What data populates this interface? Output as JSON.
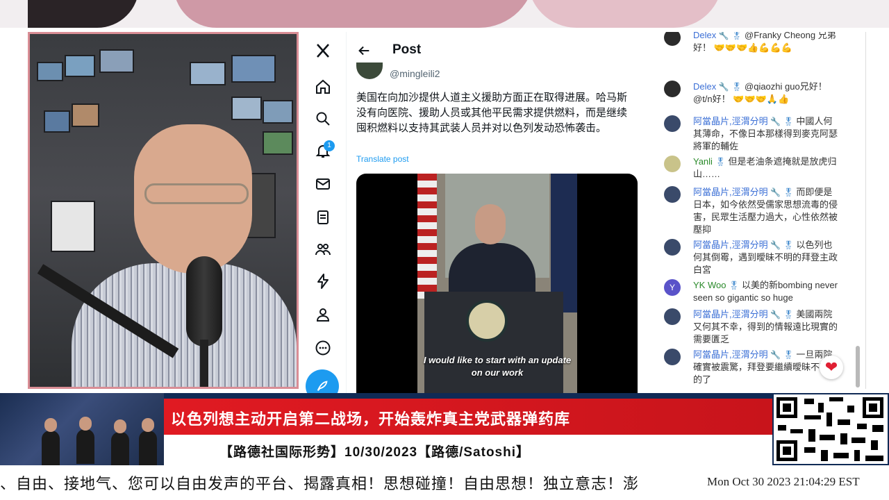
{
  "twitter": {
    "logo": "X",
    "nav_icons": [
      "x-logo",
      "home-icon",
      "search-icon",
      "bell-icon",
      "mail-icon",
      "list-icon",
      "communities-icon",
      "bolt-icon",
      "profile-icon",
      "more-icon"
    ],
    "notification_count": "1",
    "post_title": "Post",
    "handle": "@mingleili2",
    "post_text": "美国在向加沙提供人道主义援助方面正在取得进展。哈马斯没有向医院、援助人员或其他平民需求提供燃料，而是继续囤积燃料以支持其武装人员并对以色列发动恐怖袭击。",
    "translate_label": "Translate post",
    "video_caption": "I would like to start with an update on our work"
  },
  "chat": {
    "messages": [
      {
        "author": "Delex",
        "badges": "🔧 🎖",
        "text": "@Franky Cheong 兄弟好！",
        "emoji": "🤝🤝🤝👍💪💪💪"
      },
      {
        "author": "Delex",
        "badges": "🔧 🎖",
        "text": "@qiaozhi guo兄好！@t/n好！",
        "emoji": "🤝🤝🤝🙏👍"
      },
      {
        "author": "阿當晶片,涇渭分明",
        "badges": "🔧 🎖",
        "text": "中國人何其薄命，不像日本那樣得到麥克阿瑟將軍的輔佐",
        "emoji": ""
      },
      {
        "author": "Yanli",
        "badges": "🎖",
        "text": "但是老油条遮掩就是放虎归山……",
        "emoji": ""
      },
      {
        "author": "阿當晶片,涇渭分明",
        "badges": "🔧 🎖",
        "text": "而即便是日本，如今依然受儒家思想流毒的侵害，民眾生活壓力過大，心性依然被壓抑",
        "emoji": ""
      },
      {
        "author": "阿當晶片,涇渭分明",
        "badges": "🔧 🎖",
        "text": "以色列也何其倒霉，遇到曖昧不明的拜登主政白宮",
        "emoji": ""
      },
      {
        "author": "YK Woo",
        "badges": "🎖",
        "text": "以美的新bombing never seen so gigantic so huge",
        "emoji": ""
      },
      {
        "author": "阿當晶片,涇渭分明",
        "badges": "🔧 🎖",
        "text": "美國兩院又何其不幸，得到的情報遠比現實的需要匱乏",
        "emoji": ""
      },
      {
        "author": "阿當晶片,涇渭分明",
        "badges": "🔧 🎖",
        "text": "一旦兩院確實被震驚，拜登要繼續曖昧不可能的了",
        "emoji": ""
      }
    ],
    "avatar_letters": [
      "",
      "",
      "",
      "",
      "",
      "",
      "Y",
      "",
      ""
    ]
  },
  "broadcast": {
    "headline": "以色列想主动开启第二战场，开始轰炸真主党武器弹药库",
    "subline": "【路德社国际形势】10/30/2023【路德/Satoshi】",
    "ticker": "、自由、接地气、您可以自由发声的平台、揭露真相！思想碰撞！自由思想！独立意志！澎",
    "clock": "Mon Oct 30 2023 21:04:29 EST"
  },
  "colors": {
    "accent": "#1d9bf0",
    "headline_red": "#e01a22",
    "lower_navy": "#102a55",
    "webcam_border": "#d98d95"
  }
}
